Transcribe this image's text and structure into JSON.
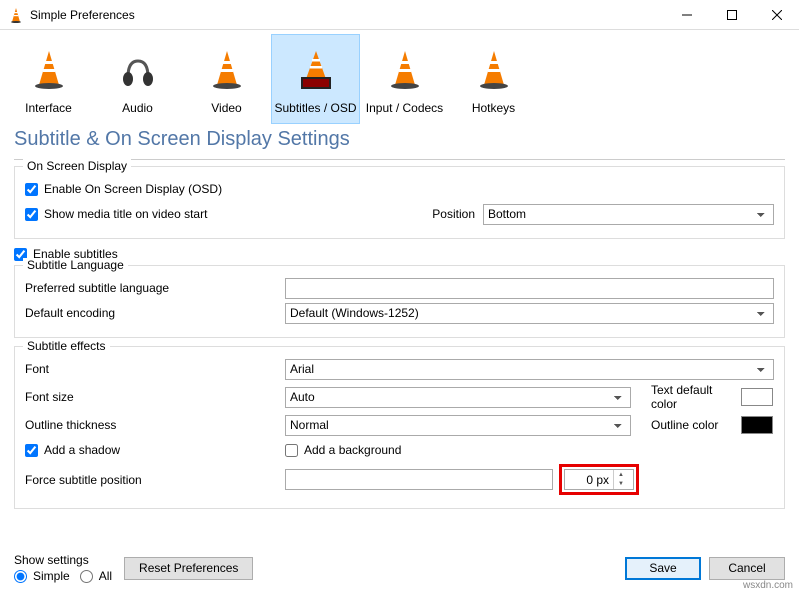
{
  "window": {
    "title": "Simple Preferences"
  },
  "toolbar": {
    "items": [
      {
        "label": "Interface"
      },
      {
        "label": "Audio"
      },
      {
        "label": "Video"
      },
      {
        "label": "Subtitles / OSD"
      },
      {
        "label": "Input / Codecs"
      },
      {
        "label": "Hotkeys"
      }
    ]
  },
  "heading": "Subtitle & On Screen Display Settings",
  "osd": {
    "group": "On Screen Display",
    "enable_osd": "Enable On Screen Display (OSD)",
    "show_title": "Show media title on video start",
    "position_label": "Position",
    "position_value": "Bottom"
  },
  "enable_subtitles": "Enable subtitles",
  "lang": {
    "group": "Subtitle Language",
    "preferred": "Preferred subtitle language",
    "encoding_label": "Default encoding",
    "encoding_value": "Default (Windows-1252)"
  },
  "effects": {
    "group": "Subtitle effects",
    "font_label": "Font",
    "font_value": "Arial",
    "size_label": "Font size",
    "size_value": "Auto",
    "default_color_label": "Text default color",
    "outline_label": "Outline thickness",
    "outline_value": "Normal",
    "outline_color_label": "Outline color",
    "shadow": "Add a shadow",
    "background": "Add a background",
    "force_pos_label": "Force subtitle position",
    "force_pos_value": "0 px"
  },
  "footer": {
    "show_label": "Show settings",
    "simple": "Simple",
    "all": "All",
    "reset": "Reset Preferences",
    "save": "Save",
    "cancel": "Cancel"
  },
  "watermark": "wsxdn.com"
}
